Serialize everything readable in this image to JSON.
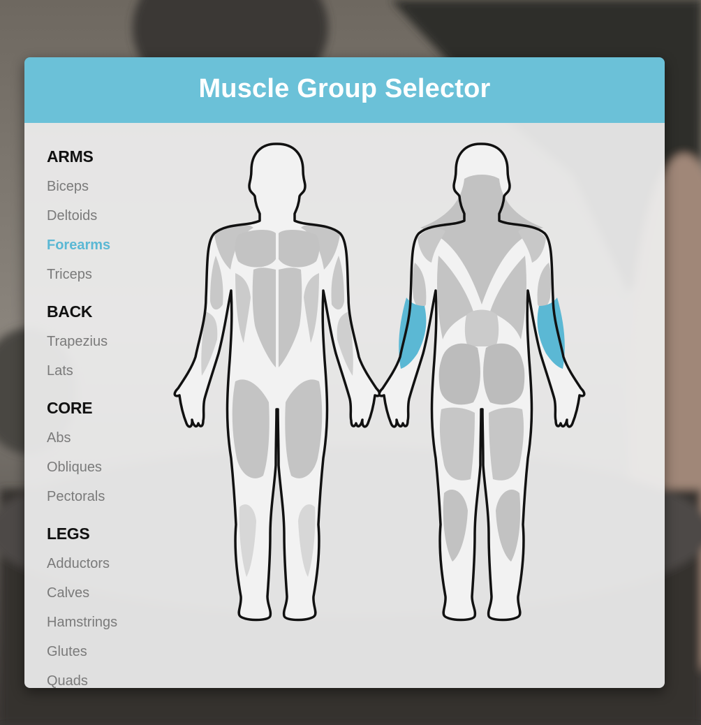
{
  "header": {
    "title": "Muscle Group Selector"
  },
  "accent_color": "#6bc1d8",
  "selected_muscle": "Forearms",
  "sidebar": {
    "groups": [
      {
        "title": "ARMS",
        "items": [
          "Biceps",
          "Deltoids",
          "Forearms",
          "Triceps"
        ]
      },
      {
        "title": "BACK",
        "items": [
          "Trapezius",
          "Lats"
        ]
      },
      {
        "title": "CORE",
        "items": [
          "Abs",
          "Obliques",
          "Pectorals"
        ]
      },
      {
        "title": "LEGS",
        "items": [
          "Adductors",
          "Calves",
          "Hamstrings",
          "Glutes",
          "Quads"
        ]
      }
    ]
  }
}
